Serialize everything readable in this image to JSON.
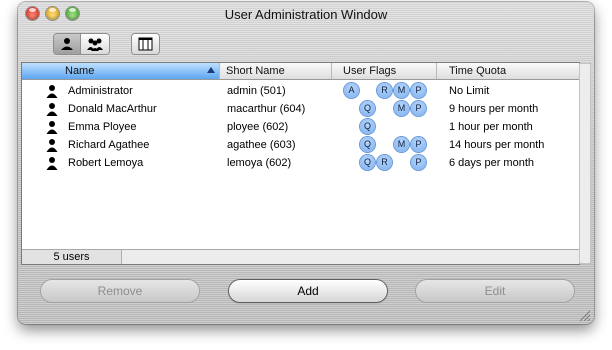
{
  "window": {
    "title": "User Administration Window"
  },
  "table": {
    "columns": [
      "Name",
      "Short Name",
      "User Flags",
      "Time Quota"
    ],
    "rows": [
      {
        "name": "Administrator",
        "short_name": "admin (501)",
        "flags": [
          "A",
          "R",
          "M",
          "P"
        ],
        "quota": "No Limit"
      },
      {
        "name": "Donald MacArthur",
        "short_name": "macarthur (604)",
        "flags": [
          "Q",
          "M",
          "P"
        ],
        "quota": "9 hours per month"
      },
      {
        "name": "Emma Ployee",
        "short_name": "ployee (602)",
        "flags": [
          "Q"
        ],
        "quota": "1 hour per month"
      },
      {
        "name": "Richard Agathee",
        "short_name": "agathee (603)",
        "flags": [
          "Q",
          "M",
          "P"
        ],
        "quota": "14 hours per month"
      },
      {
        "name": "Robert Lemoya",
        "short_name": "lemoya (602)",
        "flags": [
          "Q",
          "R",
          "P"
        ],
        "quota": "6 days per month"
      }
    ]
  },
  "status": {
    "count": "5 users"
  },
  "buttons": {
    "remove": "Remove",
    "add": "Add",
    "edit": "Edit"
  }
}
